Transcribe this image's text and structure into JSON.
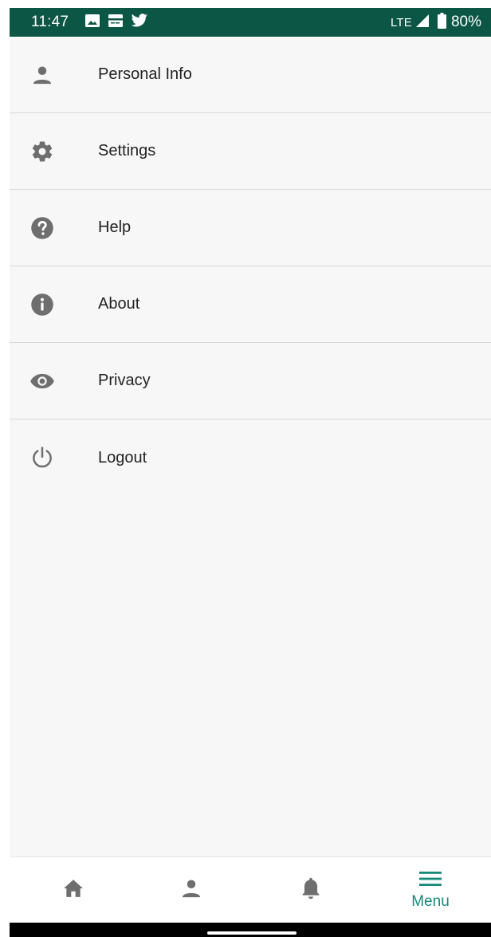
{
  "status_bar": {
    "time": "11:47",
    "network": "LTE",
    "battery": "80%",
    "icons": [
      "image-icon",
      "card-icon",
      "twitter-icon",
      "signal-icon",
      "battery-icon"
    ]
  },
  "menu": {
    "items": [
      {
        "label": "Personal Info",
        "icon": "person-icon"
      },
      {
        "label": "Settings",
        "icon": "gear-icon"
      },
      {
        "label": "Help",
        "icon": "help-icon"
      },
      {
        "label": "About",
        "icon": "info-icon"
      },
      {
        "label": "Privacy",
        "icon": "eye-icon"
      },
      {
        "label": "Logout",
        "icon": "power-icon"
      }
    ]
  },
  "bottom_nav": {
    "items": [
      {
        "icon": "home-icon"
      },
      {
        "icon": "person-icon"
      },
      {
        "icon": "bell-icon"
      },
      {
        "icon": "menu-icon",
        "label": "Menu",
        "active": true
      }
    ]
  },
  "colors": {
    "status_bar_bg": "#0b5645",
    "accent": "#17897a",
    "icon_gray": "#6e6e6e",
    "panel_bg": "#f7f7f8",
    "divider": "#d9d9d9"
  }
}
